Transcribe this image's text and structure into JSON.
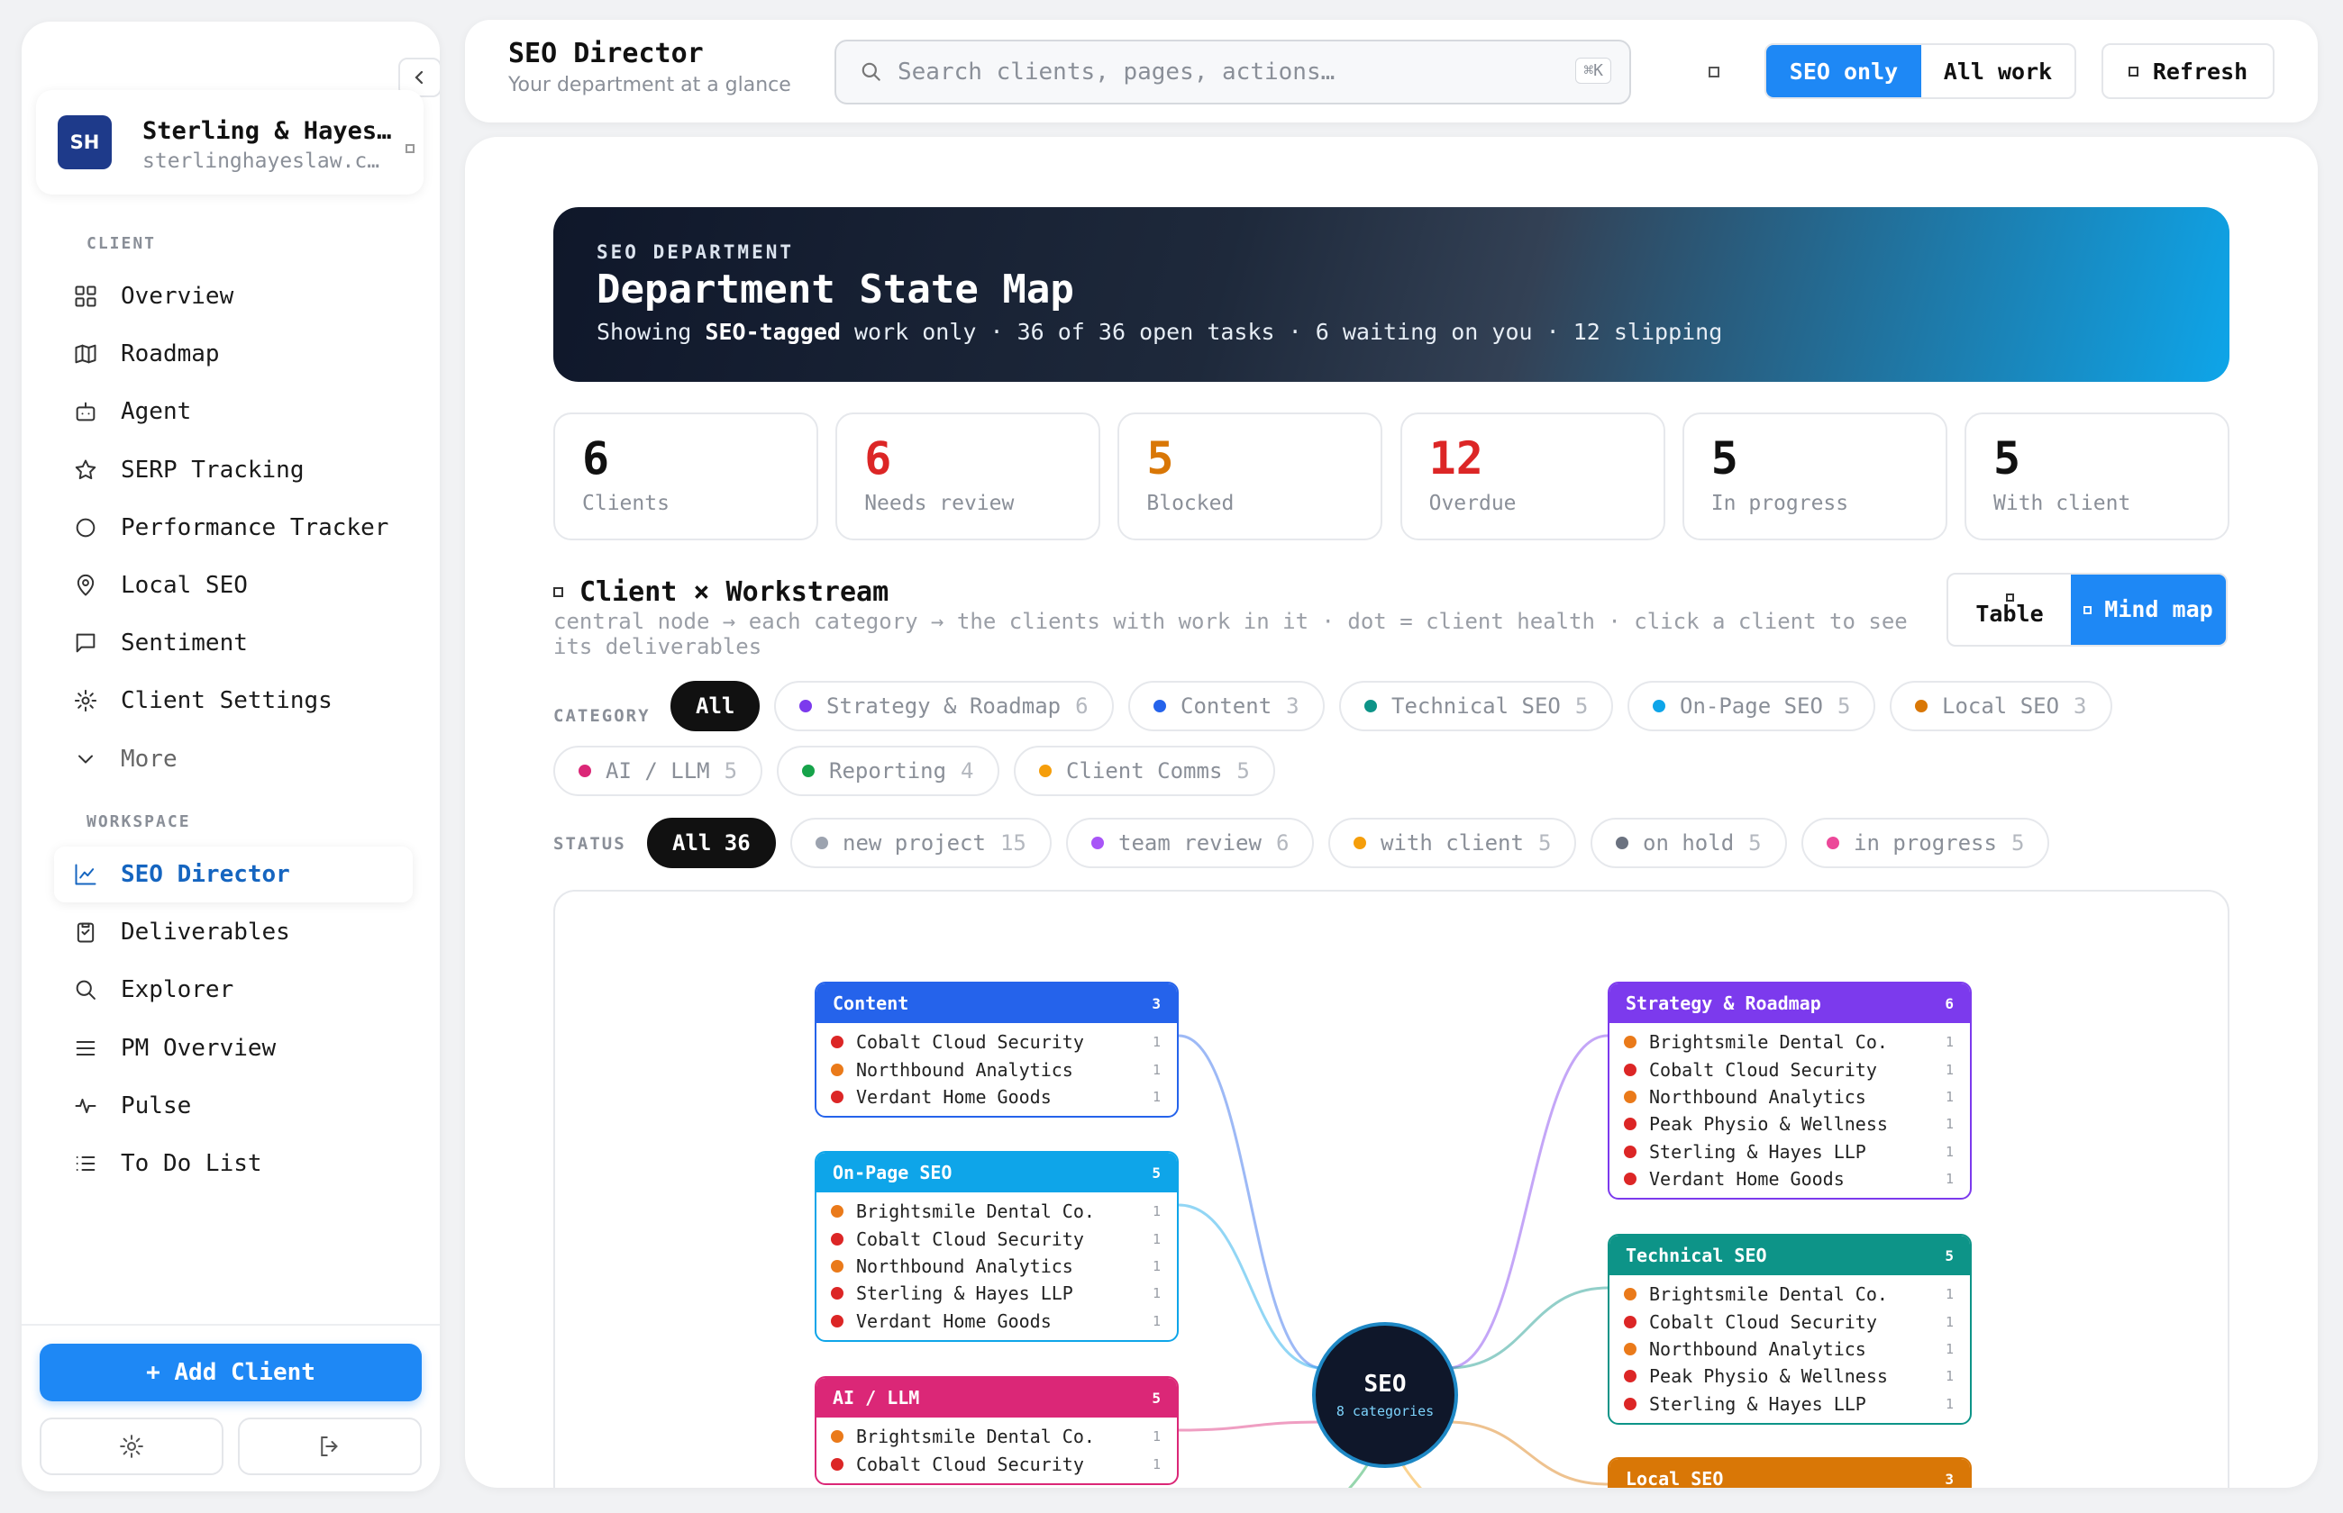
{
  "sidebar": {
    "client": {
      "initials": "SH",
      "name": "Sterling & Hayes…",
      "domain": "sterlinghayeslaw.c…"
    },
    "client_section": "CLIENT",
    "client_items": [
      {
        "label": "Overview",
        "icon": "grid-icon"
      },
      {
        "label": "Roadmap",
        "icon": "map-icon"
      },
      {
        "label": "Agent",
        "icon": "bot-icon"
      },
      {
        "label": "SERP Tracking",
        "icon": "star-icon"
      },
      {
        "label": "Performance Tracker",
        "icon": "circle-icon"
      },
      {
        "label": "Local SEO",
        "icon": "pin-icon"
      },
      {
        "label": "Sentiment",
        "icon": "message-icon"
      },
      {
        "label": "Client Settings",
        "icon": "gear-icon"
      },
      {
        "label": "More",
        "icon": "chevron-down-icon"
      }
    ],
    "workspace_section": "WORKSPACE",
    "workspace_items": [
      {
        "label": "SEO Director",
        "icon": "chart-line-icon",
        "active": true
      },
      {
        "label": "Deliverables",
        "icon": "clipboard-icon"
      },
      {
        "label": "Explorer",
        "icon": "search-icon"
      },
      {
        "label": "PM Overview",
        "icon": "menu-icon"
      },
      {
        "label": "Pulse",
        "icon": "pulse-icon"
      },
      {
        "label": "To Do List",
        "icon": "list-icon"
      }
    ],
    "add_client": "+ Add Client"
  },
  "topbar": {
    "title": "SEO Director",
    "subtitle": "Your department at a glance",
    "search_placeholder": "Search clients, pages, actions…",
    "shortcut": "⌘K",
    "seg_seo": "SEO only",
    "seg_all": "All work",
    "refresh": "Refresh"
  },
  "hero": {
    "eyebrow": "SEO DEPARTMENT",
    "title": "Department State Map",
    "s_pre": "Showing ",
    "s_bold": "SEO-tagged",
    "s_post": " work only · 36 of 36 open tasks · 6 waiting on you · 12 slipping"
  },
  "stats": [
    {
      "value": "6",
      "label": "Clients",
      "color": "#111111"
    },
    {
      "value": "6",
      "label": "Needs review",
      "color": "#dc2626"
    },
    {
      "value": "5",
      "label": "Blocked",
      "color": "#d97706"
    },
    {
      "value": "12",
      "label": "Overdue",
      "color": "#dc2626"
    },
    {
      "value": "5",
      "label": "In progress",
      "color": "#111111"
    },
    {
      "value": "5",
      "label": "With client",
      "color": "#111111"
    }
  ],
  "workstream": {
    "title": "Client × Workstream",
    "desc": "central node → each category → the clients with work in it · dot = client health · click a client to see its deliverables",
    "view_table": "Table",
    "view_mind": "Mind map"
  },
  "category_filter": {
    "label": "CATEGORY",
    "all": "All",
    "chips": [
      {
        "label": "Strategy & Roadmap",
        "count": "6",
        "color": "#7c3aed"
      },
      {
        "label": "Content",
        "count": "3",
        "color": "#2563eb"
      },
      {
        "label": "Technical SEO",
        "count": "5",
        "color": "#0d9488"
      },
      {
        "label": "On-Page SEO",
        "count": "5",
        "color": "#0ea5e9"
      },
      {
        "label": "Local SEO",
        "count": "3",
        "color": "#d97706"
      },
      {
        "label": "AI / LLM",
        "count": "5",
        "color": "#db2777"
      },
      {
        "label": "Reporting",
        "count": "4",
        "color": "#16a34a"
      },
      {
        "label": "Client Comms",
        "count": "5",
        "color": "#f59e0b"
      }
    ]
  },
  "status_filter": {
    "label": "STATUS",
    "all": "All 36",
    "chips": [
      {
        "label": "new project",
        "count": "15",
        "color": "#9ca3af"
      },
      {
        "label": "team review",
        "count": "6",
        "color": "#a855f7"
      },
      {
        "label": "with client",
        "count": "5",
        "color": "#f59e0b"
      },
      {
        "label": "on hold",
        "count": "5",
        "color": "#6b7280"
      },
      {
        "label": "in progress",
        "count": "5",
        "color": "#ec4899"
      }
    ]
  },
  "mindmap": {
    "center_title": "SEO",
    "center_sub": "8 categories",
    "nodes": [
      {
        "title": "Content",
        "count": "3",
        "color": "#2563eb",
        "items": [
          {
            "name": "Cobalt Cloud Security",
            "n": "1",
            "health": "#dc2626"
          },
          {
            "name": "Northbound Analytics",
            "n": "1",
            "health": "#ea7a1a"
          },
          {
            "name": "Verdant Home Goods",
            "n": "1",
            "health": "#dc2626"
          }
        ]
      },
      {
        "title": "On-Page SEO",
        "count": "5",
        "color": "#0ea5e9",
        "items": [
          {
            "name": "Brightsmile Dental Co.",
            "n": "1",
            "health": "#ea7a1a"
          },
          {
            "name": "Cobalt Cloud Security",
            "n": "1",
            "health": "#dc2626"
          },
          {
            "name": "Northbound Analytics",
            "n": "1",
            "health": "#ea7a1a"
          },
          {
            "name": "Sterling & Hayes LLP",
            "n": "1",
            "health": "#dc2626"
          },
          {
            "name": "Verdant Home Goods",
            "n": "1",
            "health": "#dc2626"
          }
        ]
      },
      {
        "title": "AI / LLM",
        "count": "5",
        "color": "#db2777",
        "items": [
          {
            "name": "Brightsmile Dental Co.",
            "n": "1",
            "health": "#ea7a1a"
          },
          {
            "name": "Cobalt Cloud Security",
            "n": "1",
            "health": "#dc2626"
          }
        ]
      },
      {
        "title": "Strategy & Roadmap",
        "count": "6",
        "color": "#7c3aed",
        "items": [
          {
            "name": "Brightsmile Dental Co.",
            "n": "1",
            "health": "#ea7a1a"
          },
          {
            "name": "Cobalt Cloud Security",
            "n": "1",
            "health": "#dc2626"
          },
          {
            "name": "Northbound Analytics",
            "n": "1",
            "health": "#ea7a1a"
          },
          {
            "name": "Peak Physio & Wellness",
            "n": "1",
            "health": "#dc2626"
          },
          {
            "name": "Sterling & Hayes LLP",
            "n": "1",
            "health": "#dc2626"
          },
          {
            "name": "Verdant Home Goods",
            "n": "1",
            "health": "#dc2626"
          }
        ]
      },
      {
        "title": "Technical SEO",
        "count": "5",
        "color": "#0d9488",
        "items": [
          {
            "name": "Brightsmile Dental Co.",
            "n": "1",
            "health": "#ea7a1a"
          },
          {
            "name": "Cobalt Cloud Security",
            "n": "1",
            "health": "#dc2626"
          },
          {
            "name": "Northbound Analytics",
            "n": "1",
            "health": "#ea7a1a"
          },
          {
            "name": "Peak Physio & Wellness",
            "n": "1",
            "health": "#dc2626"
          },
          {
            "name": "Sterling & Hayes LLP",
            "n": "1",
            "health": "#dc2626"
          }
        ]
      },
      {
        "title": "Local SEO",
        "count": "3",
        "color": "#d97706",
        "items": []
      }
    ]
  }
}
